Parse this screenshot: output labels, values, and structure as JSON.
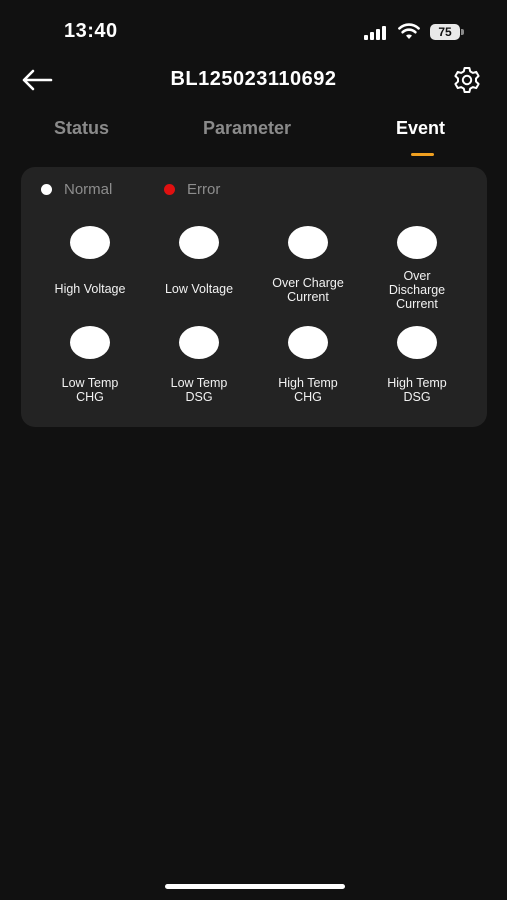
{
  "status_bar": {
    "time": "13:40",
    "battery_level": "75"
  },
  "header": {
    "title": "BL125023110692",
    "back_icon": "arrow-left-icon",
    "settings_icon": "gear-icon"
  },
  "tabs": [
    {
      "label": "Status",
      "active": false
    },
    {
      "label": "Parameter",
      "active": false
    },
    {
      "label": "Event",
      "active": true
    }
  ],
  "colors": {
    "background": "#111111",
    "card": "#232323",
    "accent": "#f0a020",
    "normal": "#ffffff",
    "error": "#e01010",
    "muted_text": "#8d8d8d"
  },
  "legend": {
    "normal_label": "Normal",
    "error_label": "Error"
  },
  "events": [
    {
      "label_lines": [
        "High Voltage"
      ],
      "state": "normal"
    },
    {
      "label_lines": [
        "Low Voltage"
      ],
      "state": "normal"
    },
    {
      "label_lines": [
        "Over Charge",
        "Current"
      ],
      "state": "normal"
    },
    {
      "label_lines": [
        "Over",
        "Discharge",
        "Current"
      ],
      "state": "normal"
    },
    {
      "label_lines": [
        "Low Temp",
        "CHG"
      ],
      "state": "normal"
    },
    {
      "label_lines": [
        "Low Temp",
        "DSG"
      ],
      "state": "normal"
    },
    {
      "label_lines": [
        "High Temp",
        "CHG"
      ],
      "state": "normal"
    },
    {
      "label_lines": [
        "High Temp",
        "DSG"
      ],
      "state": "normal"
    }
  ]
}
